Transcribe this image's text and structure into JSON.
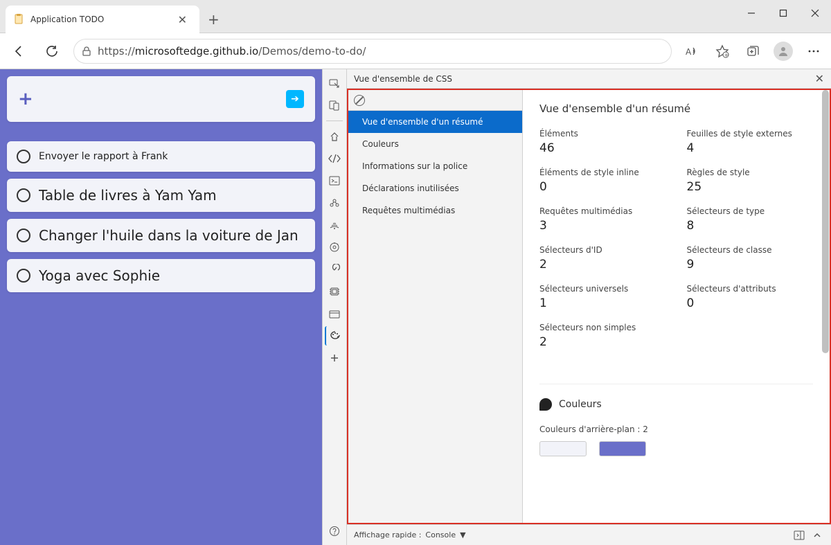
{
  "window": {
    "tab_title": "Application TODO"
  },
  "address": {
    "url_prefix": "https://",
    "url_host": "microsoftedge.github.io",
    "url_path": "/Demos/demo-to-do/"
  },
  "todo": {
    "items": [
      {
        "text": "Envoyer le rapport à Frank",
        "small": true
      },
      {
        "text": "Table de livres à Yam Yam",
        "small": false
      },
      {
        "text": "Changer l'huile dans la voiture de Jan",
        "small": false
      },
      {
        "text": "Yoga avec Sophie",
        "small": false
      }
    ]
  },
  "devtools": {
    "panel_title": "Vue d'ensemble de CSS",
    "nav": [
      "Vue d'ensemble d'un résumé",
      "Couleurs",
      "Informations sur la police",
      "Déclarations inutilisées",
      "Requêtes multimédias"
    ],
    "content_title": "Vue d'ensemble d'un résumé",
    "stats": [
      {
        "label": "Éléments",
        "value": "46"
      },
      {
        "label": "Feuilles de style externes",
        "value": "4"
      },
      {
        "label": "Éléments de style inline",
        "value": "0"
      },
      {
        "label": "Règles de style",
        "value": "25"
      },
      {
        "label": "Requêtes multimédias",
        "value": "3"
      },
      {
        "label": "Sélecteurs de type",
        "value": "8"
      },
      {
        "label": "Sélecteurs d'ID",
        "value": "2"
      },
      {
        "label": "Sélecteurs de classe",
        "value": "9"
      },
      {
        "label": "Sélecteurs universels",
        "value": "1"
      },
      {
        "label": "Sélecteurs d'attributs",
        "value": "0"
      },
      {
        "label": "Sélecteurs non simples",
        "value": "2"
      }
    ],
    "colors_section_title": "Couleurs",
    "colors_bg_label": "Couleurs d'arrière-plan : 2",
    "swatches": [
      "#f2f3f9",
      "#6a6fc9"
    ],
    "drawer_label": "Affichage rapide :",
    "drawer_tab": "Console"
  }
}
